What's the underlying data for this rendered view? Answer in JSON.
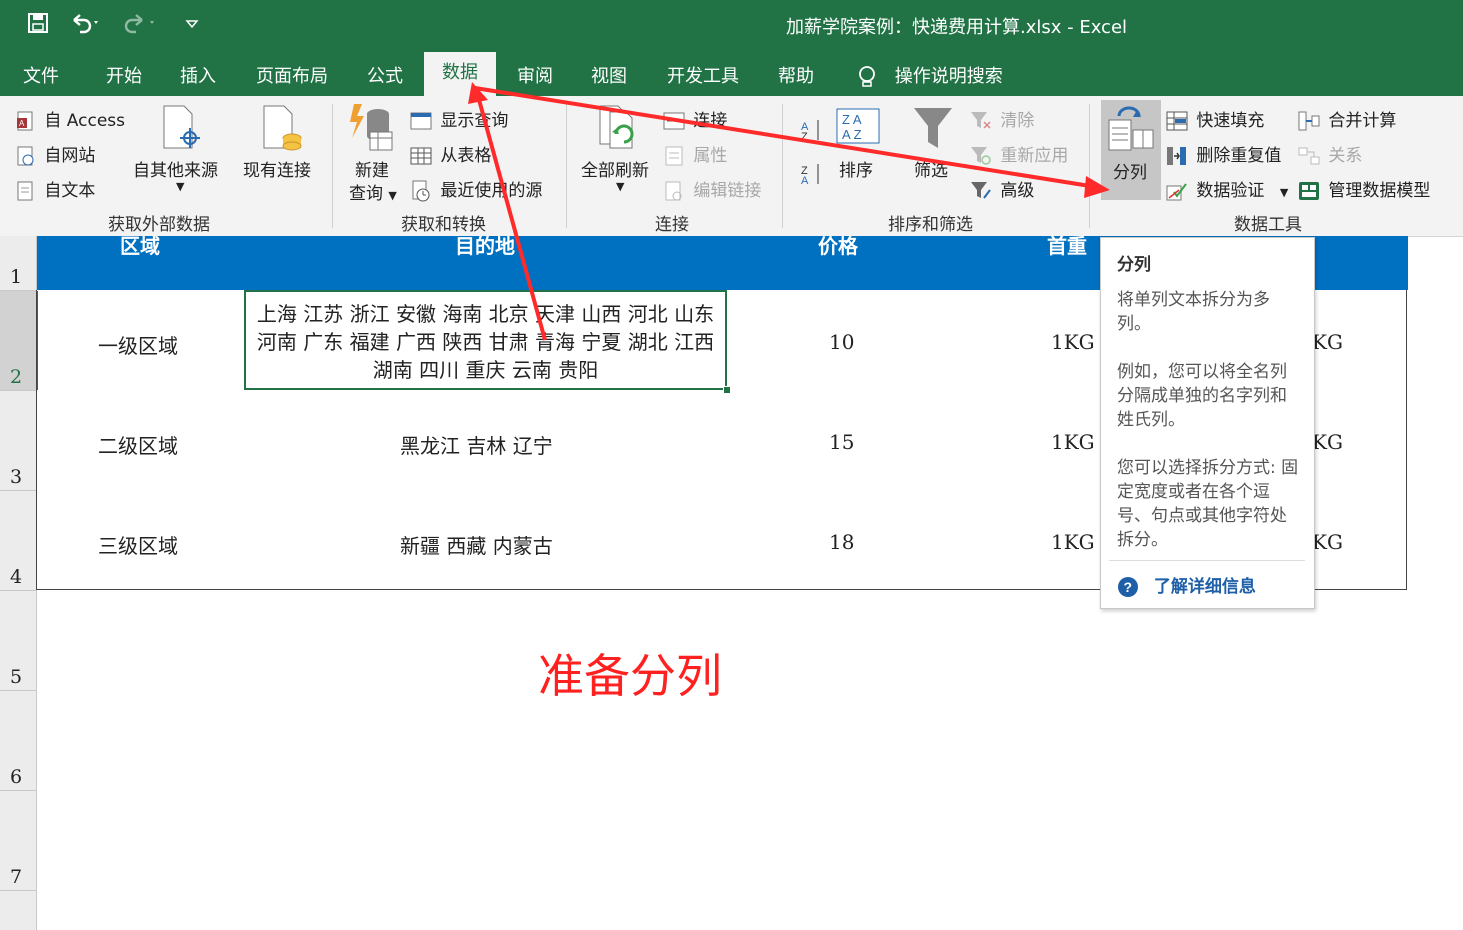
{
  "title_bar": {
    "title": "加薪学院案例：快递费用计算.xlsx  -  Excel",
    "save_icon": "save-icon",
    "undo_icon": "undo-icon",
    "redo_icon": "redo-icon",
    "customize_icon": "customize-qat-icon"
  },
  "tabs": [
    "文件",
    "开始",
    "插入",
    "页面布局",
    "公式",
    "数据",
    "审阅",
    "视图",
    "开发工具",
    "帮助"
  ],
  "active_tab": "数据",
  "search_label": "操作说明搜索",
  "ribbon": {
    "get_external": {
      "label": "获取外部数据",
      "access": "自 Access",
      "web": "自网站",
      "text": "自文本",
      "other": "自其他来源",
      "existing": "现有连接"
    },
    "get_transform": {
      "label": "获取和转换",
      "new_query_1": "新建",
      "new_query_2": "查询",
      "show_queries": "显示查询",
      "from_table": "从表格",
      "recent_sources": "最近使用的源"
    },
    "connections": {
      "label": "连接",
      "refresh_all": "全部刷新",
      "connections": "连接",
      "properties": "属性",
      "edit_links": "编辑链接"
    },
    "sort_filter": {
      "label": "排序和筛选",
      "sort": "排序",
      "filter": "筛选",
      "clear": "清除",
      "reapply": "重新应用",
      "advanced": "高级"
    },
    "data_tools": {
      "label": "数据工具",
      "text_to_columns": "分列",
      "flash_fill": "快速填充",
      "remove_duplicates": "删除重复值",
      "data_validation": "数据验证",
      "consolidate": "合并计算",
      "relationships": "关系",
      "manage_model": "管理数据模型"
    }
  },
  "sheet": {
    "row_numbers": [
      "1",
      "2",
      "3",
      "4",
      "5",
      "6",
      "7"
    ],
    "headers": [
      "区域",
      "目的地",
      "价格",
      "首重"
    ],
    "rows": [
      {
        "region": "一级区域",
        "dest": "上海  江苏  浙江  安徽  海南  北京  天津  山西  河北  山东  河南  广东  福建  广西  陕西  甘肃  青海  宁夏  湖北  江西  湖南  四川  重庆  云南  贵阳",
        "price": "10",
        "weight": "1KG",
        "extra": "KG"
      },
      {
        "region": "二级区域",
        "dest": "黑龙江  吉林  辽宁",
        "price": "15",
        "weight": "1KG",
        "extra": "KG"
      },
      {
        "region": "三级区域",
        "dest": "新疆  西藏  内蒙古",
        "price": "18",
        "weight": "1KG",
        "extra": "KG"
      }
    ],
    "annotation": "准备分列"
  },
  "tooltip": {
    "title": "分列",
    "p1": "将单列文本拆分为多列。",
    "p2": "例如，您可以将全名列分隔成单独的名字列和姓氏列。",
    "p3": "您可以选择拆分方式: 固定宽度或者在各个逗号、句点或其他字符处拆分。",
    "link": "了解详细信息"
  },
  "colors": {
    "excel_green": "#217346",
    "header_blue": "#0070c0",
    "annotation_red": "#ff2020"
  }
}
